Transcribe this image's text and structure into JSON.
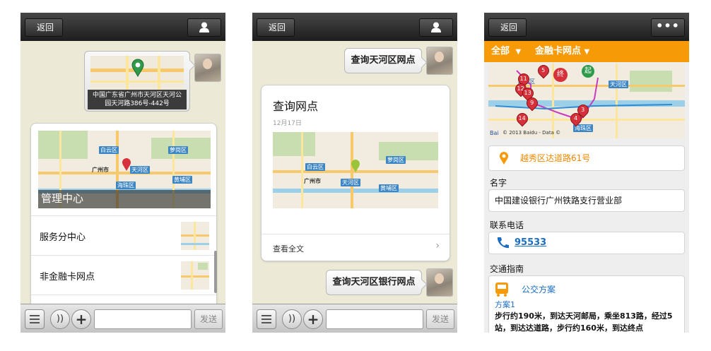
{
  "colors": {
    "accent_orange": "#f79a08",
    "link_blue": "#1b6ec2",
    "pin_red": "#d6303a",
    "pin_green": "#2e9b4a"
  },
  "icons": [
    "user-icon",
    "more-icon",
    "list-icon",
    "voice-icon",
    "plus-icon",
    "location-icon",
    "phone-icon",
    "bus-icon",
    "chevron-right-icon"
  ],
  "phone1": {
    "back": "返回",
    "location_caption": "中国广东省广州市天河区天河公园天河路386号-442号",
    "map_labels": [
      "白云区",
      "萝岗区",
      "广州市",
      "天河区",
      "黄埔区",
      "海珠区"
    ],
    "card_title": "管理中心",
    "items": [
      {
        "label": "服务分中心"
      },
      {
        "label": "非金融卡网点"
      }
    ],
    "send": "发送"
  },
  "phone2": {
    "back": "返回",
    "query1": "查询天河区网点",
    "card_title": "查询网点",
    "card_date": "12月17日",
    "map_labels": [
      "白云区",
      "萝岗区",
      "广州市",
      "天河区",
      "黄埔区"
    ],
    "card_footer": "查看全文",
    "query2": "查询天河区银行网点",
    "send": "发送"
  },
  "phone3": {
    "back": "返回",
    "filter_all": "全部",
    "filter_type": "金融卡网点",
    "map_labels": [
      "天河区",
      "海珠区",
      "越秀区"
    ],
    "map_pins": [
      "5",
      "终",
      "起",
      "11",
      "12",
      "13",
      "9",
      "3",
      "4",
      "14"
    ],
    "map_copyright": "© 2013 Baidu - Data ©",
    "address": "越秀区达道路61号",
    "name_label": "名字",
    "name_value": "中国建设银行广州铁路支行营业部",
    "phone_label": "联系电话",
    "phone_value": "95533",
    "guide_label": "交通指南",
    "bus_title": "公交方案",
    "plan": "方案1",
    "route_text": "步行约190米，到达天河邮局，乘坐813路，经过5站，到达达道路，步行约160米，到达终点"
  }
}
